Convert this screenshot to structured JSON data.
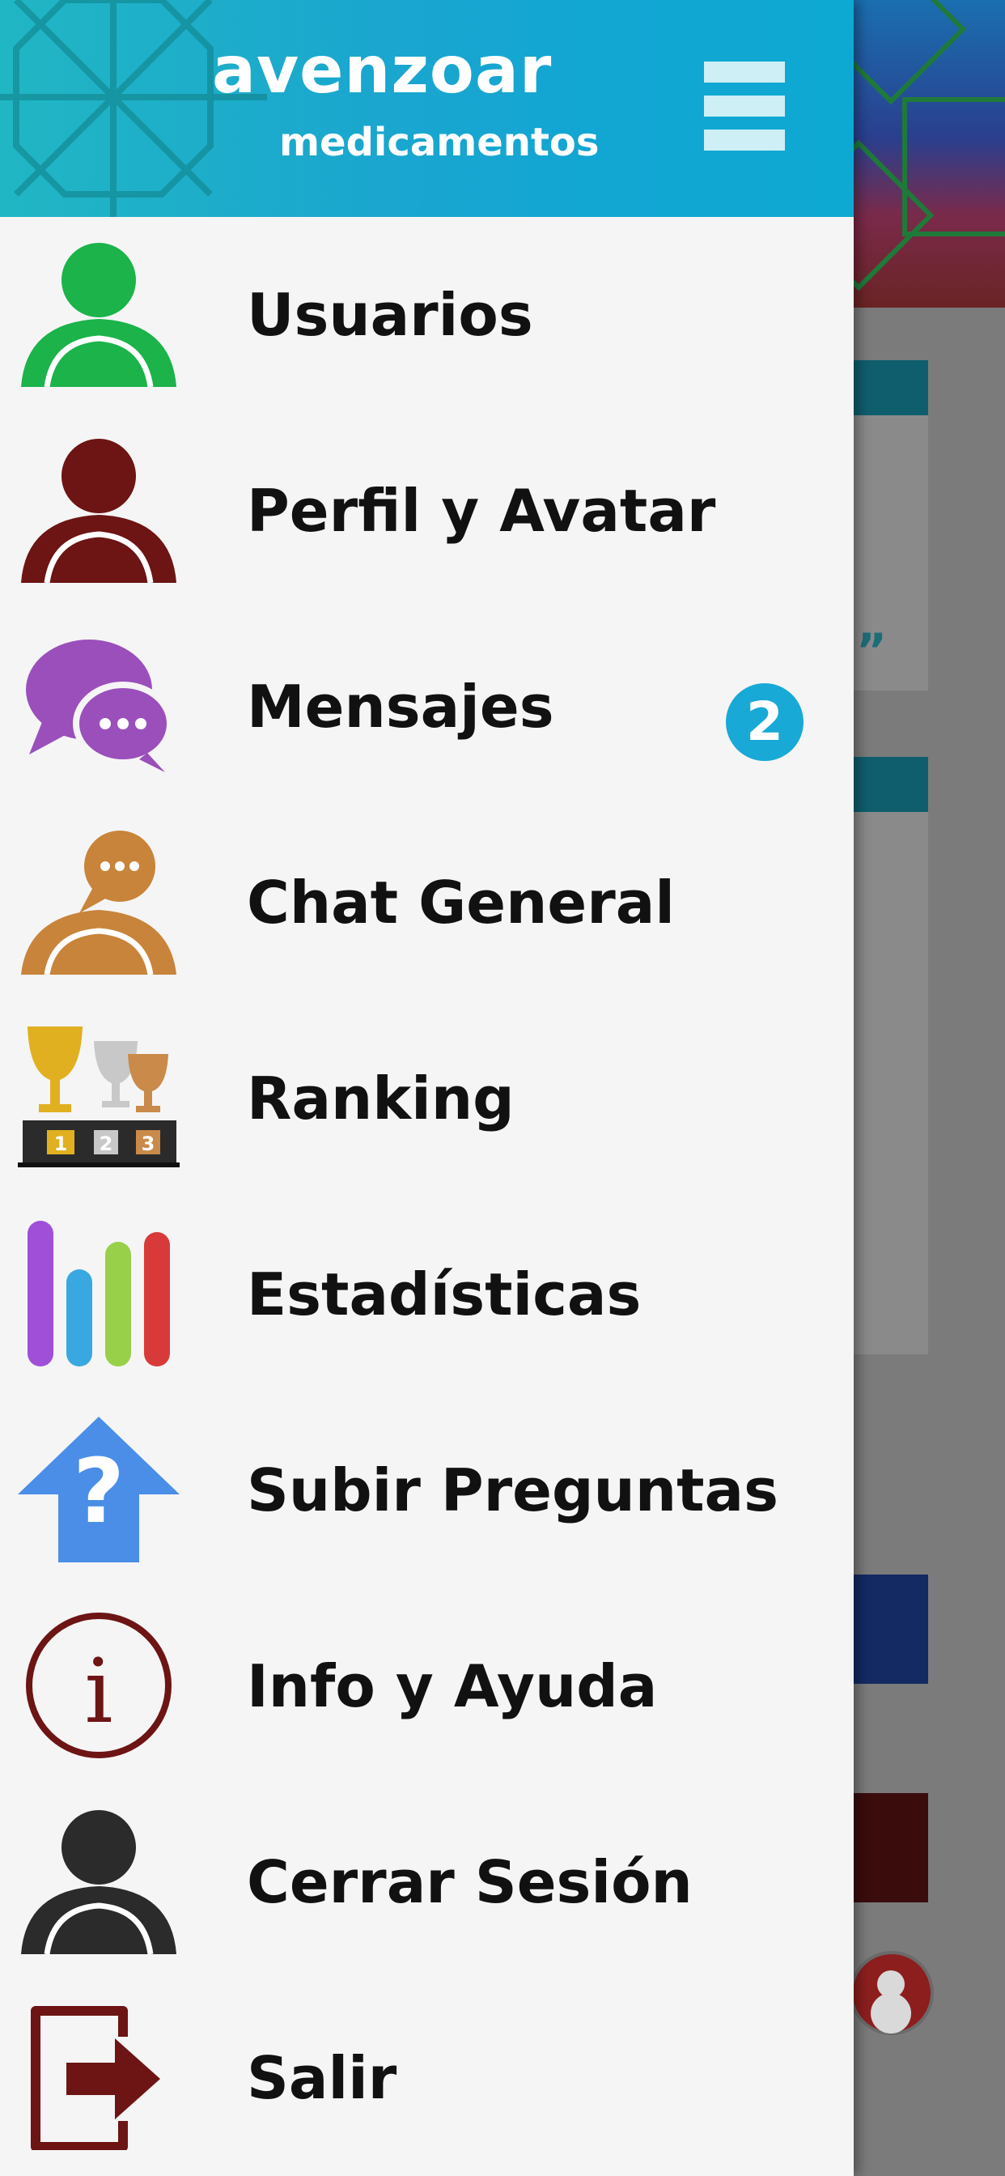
{
  "app": {
    "logo_main": "avenzoar",
    "logo_sub": "medicamentos"
  },
  "colors": {
    "header_accent": "#12a6d3",
    "badge": "#18a9d6",
    "drawer_bg": "#f5f5f5"
  },
  "menu": {
    "items": [
      {
        "label": "Usuarios",
        "icon": "user-green-icon",
        "color": "#1bb34a"
      },
      {
        "label": "Perfil y Avatar",
        "icon": "user-maroon-icon",
        "color": "#6d1414"
      },
      {
        "label": "Mensajes",
        "icon": "chat-bubbles-icon",
        "color": "#9a4fbb",
        "badge": "2"
      },
      {
        "label": "Chat General",
        "icon": "user-chat-icon",
        "color": "#c8843a"
      },
      {
        "label": "Ranking",
        "icon": "trophies-podium-icon"
      },
      {
        "label": "Estadísticas",
        "icon": "bar-stats-icon"
      },
      {
        "label": "Subir Preguntas",
        "icon": "upload-question-icon",
        "color": "#4a8ee8"
      },
      {
        "label": "Info y Ayuda",
        "icon": "info-circle-icon",
        "color": "#6d1414"
      },
      {
        "label": "Cerrar Sesión",
        "icon": "user-dark-icon",
        "color": "#2b2b2b"
      },
      {
        "label": "Salir",
        "icon": "exit-door-icon",
        "color": "#6d1414"
      }
    ]
  }
}
